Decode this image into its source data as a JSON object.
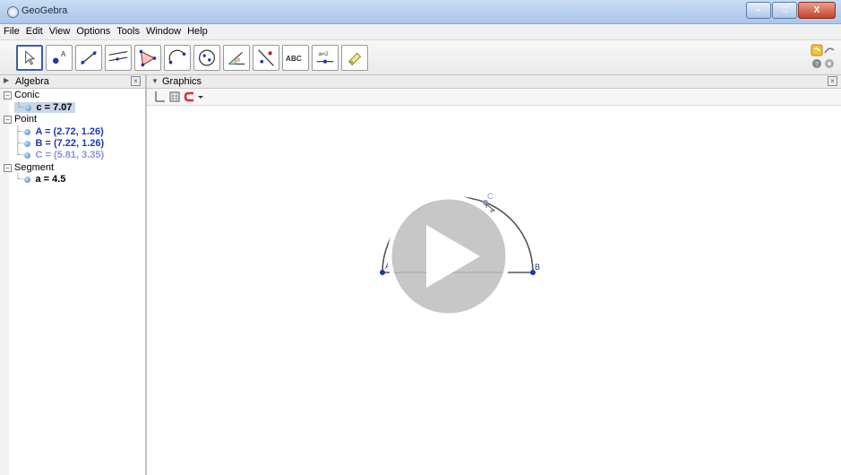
{
  "window": {
    "title": "GeoGebra",
    "minimize": "–",
    "maximize": "□",
    "close": "X"
  },
  "menu": [
    "File",
    "Edit",
    "View",
    "Options",
    "Tools",
    "Window",
    "Help"
  ],
  "toolbar": {
    "tools": [
      {
        "icon": "move-arrow-icon"
      },
      {
        "icon": "point-icon",
        "label": "A"
      },
      {
        "icon": "line-icon"
      },
      {
        "icon": "perpendicular-line-icon"
      },
      {
        "icon": "polygon-icon"
      },
      {
        "icon": "arc-icon"
      },
      {
        "icon": "circle-icon"
      },
      {
        "icon": "angle-icon",
        "label": "α"
      },
      {
        "icon": "reflect-icon"
      },
      {
        "icon": "text-icon",
        "label": "ABC"
      },
      {
        "icon": "slider-icon",
        "label": "a=2"
      },
      {
        "icon": "move-graphics-view-icon"
      }
    ]
  },
  "algebra": {
    "header": "Algebra",
    "groups": [
      {
        "name": "Conic",
        "items": [
          {
            "text": "c = 7.07",
            "color": "#000000",
            "selected": true
          }
        ]
      },
      {
        "name": "Point",
        "items": [
          {
            "text": "A = (2.72, 1.26)",
            "color": "#1c3aa8"
          },
          {
            "text": "B = (7.22, 1.26)",
            "color": "#1c3aa8"
          },
          {
            "text": "C = (5.81, 3.35)",
            "color": "#8b94d6"
          }
        ]
      },
      {
        "name": "Segment",
        "items": [
          {
            "text": "a = 4.5",
            "color": "#000000"
          }
        ]
      }
    ]
  },
  "graphics": {
    "header": "Graphics",
    "labels": {
      "A": "A",
      "B": "B",
      "C": "C"
    }
  }
}
